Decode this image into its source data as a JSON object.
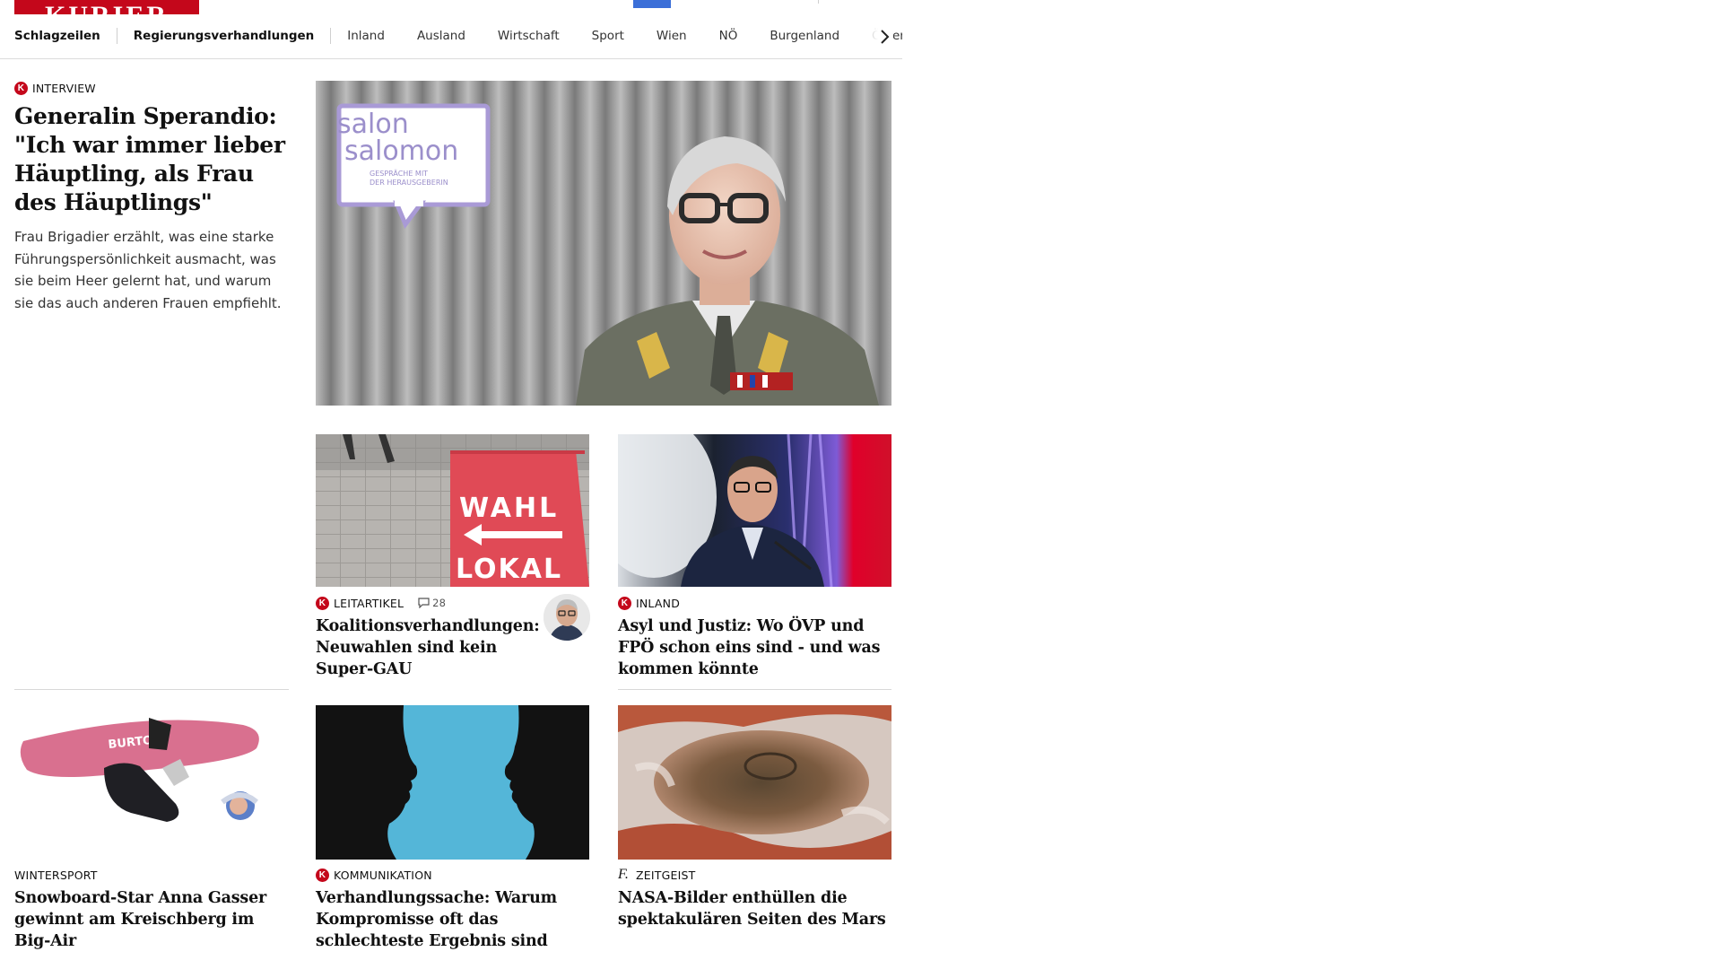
{
  "header": {
    "brand": "KURIER",
    "nav": [
      "Schlagzeilen",
      "Regierungsverhandlungen",
      "Inland",
      "Ausland",
      "Wirtschaft",
      "Sport",
      "Wien",
      "NÖ",
      "Burgenland",
      "Öster"
    ]
  },
  "hero": {
    "kicker": "INTERVIEW",
    "headline": "Generalin Sperandio: \"Ich war immer lieber Häupt­ling, als Frau des Häuptlings\"",
    "teaser": "Frau Brigadier erzählt, was eine starke Führungspersönlichkeit ausmacht, was sie beim Heer gelernt hat, und warum sie das auch anderen Frauen empfiehlt.",
    "image_badge": {
      "line1": "salon",
      "line2": "salomon",
      "line3": "GESPRÄCHE MIT",
      "line4": "DER HERAUSGEBERIN"
    }
  },
  "row1": [
    {
      "kicker": "LEITARTIKEL",
      "comments": "28",
      "headline": "Koalitionsverhandlungen: Neuwahlen sind kein Su­per-GAU",
      "image_text": [
        "WAHL",
        "LOKAL"
      ]
    },
    {
      "kicker": "INLAND",
      "headline": "Asyl und Justiz: Wo ÖVP und FPÖ schon eins sind - und was kommen könnte"
    }
  ],
  "row2": [
    {
      "kicker": "WINTERSPORT",
      "headline": "Snowboard-Star Anna Gasser ge­winnt am Kreischberg im Big-Air",
      "image_text": "BURTON"
    },
    {
      "kicker": "KOMMUNIKATION",
      "headline": "Verhandlungssache: Warum Kom­promisse oft das schlechteste Er­gebnis sind"
    },
    {
      "kicker": "ZEITGEIST",
      "headline": "NASA-Bilder enthüllen die spekta­kulären Seiten des Mars"
    }
  ],
  "colors": {
    "brand_red": "#c4071b",
    "top_blue": "#3b6fd8",
    "badge_purple": "#a99ad6",
    "mars_red": "#b9583c"
  }
}
